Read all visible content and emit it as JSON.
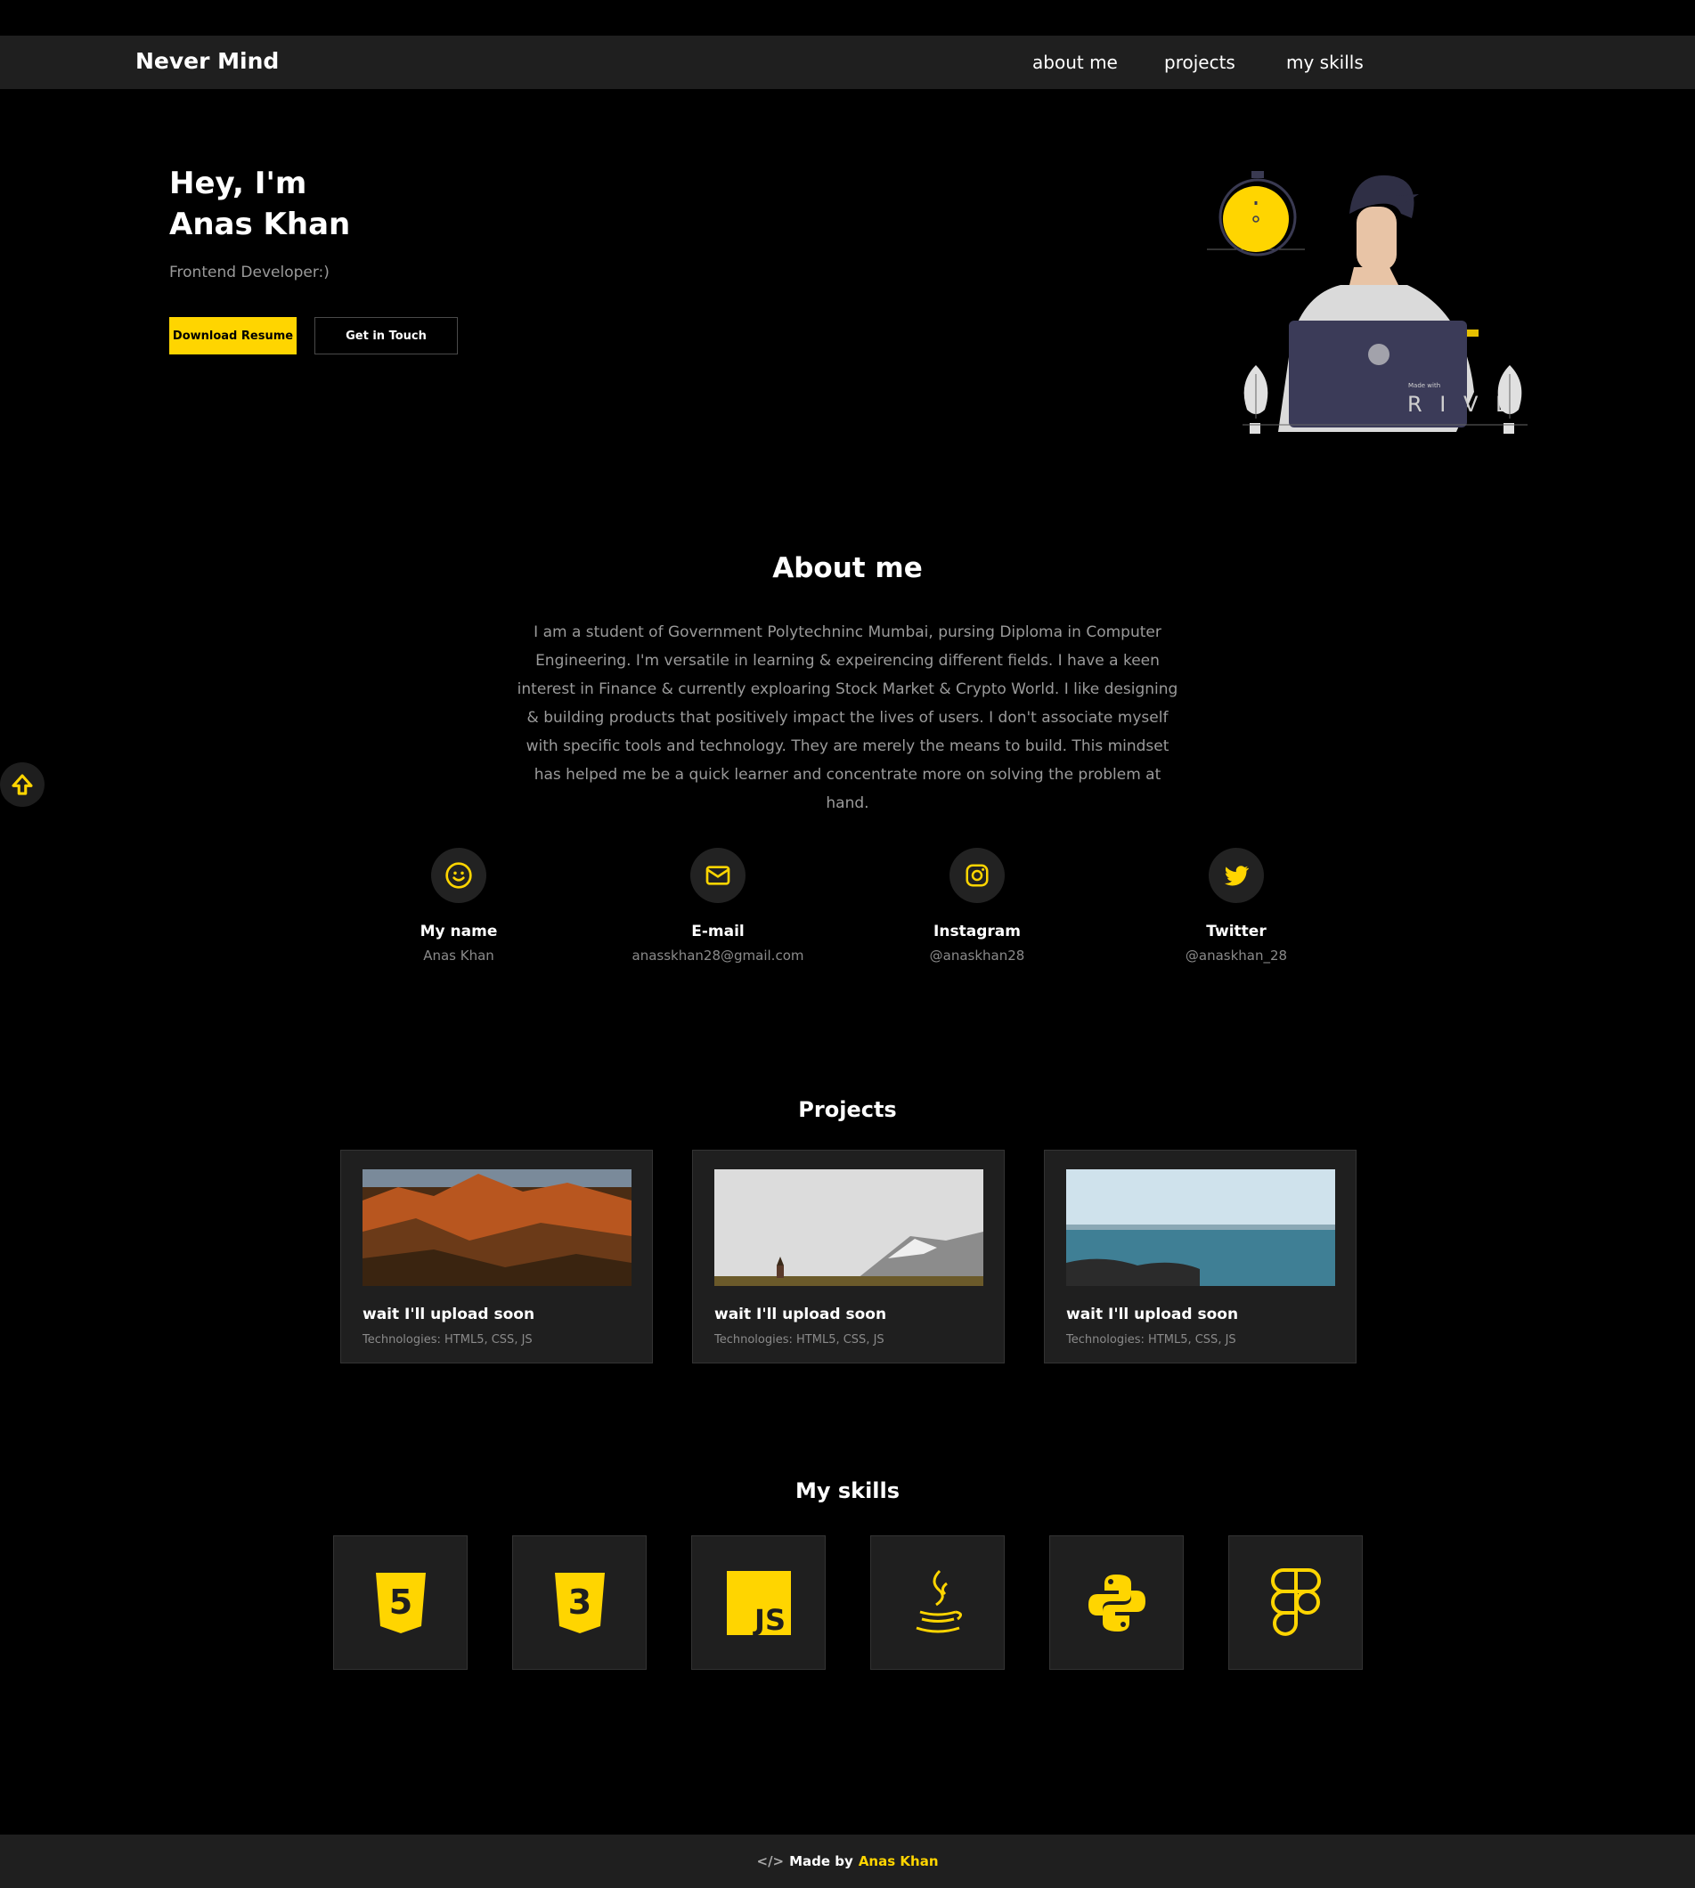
{
  "nav": {
    "brand": "Never Mind",
    "links": [
      "about me",
      "projects",
      "my skills"
    ]
  },
  "hero": {
    "greeting": "Hey, I'm",
    "name": "Anas Khan",
    "role": "Frontend Developer:)",
    "download_label": "Download Resume",
    "contact_label": "Get in Touch",
    "illustration_badge": "Made with",
    "illustration_brand": "R I V E"
  },
  "about": {
    "title": "About me",
    "text": "I am a student of Government Polytechninc Mumbai, pursing Diploma in Computer Engineering. I'm versatile in learning & expeirencing different fields. I have a keen interest in Finance & currently exploaring Stock Market & Crypto World. I like designing & building products that positively impact the lives of users. I don't associate myself with specific tools and technology. They are merely the means to build. This mindset has helped me be a quick learner and concentrate more on solving the problem at hand."
  },
  "contacts": [
    {
      "label": "My name",
      "value": "Anas Khan",
      "icon": "smile-icon"
    },
    {
      "label": "E-mail",
      "value": "anasskhan28@gmail.com",
      "icon": "mail-icon"
    },
    {
      "label": "Instagram",
      "value": "@anaskhan28",
      "icon": "instagram-icon"
    },
    {
      "label": "Twitter",
      "value": "@anaskhan_28",
      "icon": "twitter-icon"
    }
  ],
  "projects": {
    "title": "Projects",
    "items": [
      {
        "title": "wait I'll upload soon",
        "tech": "Technologies: HTML5, CSS, JS"
      },
      {
        "title": "wait I'll upload soon",
        "tech": "Technologies: HTML5, CSS, JS"
      },
      {
        "title": "wait I'll upload soon",
        "tech": "Technologies: HTML5, CSS, JS"
      }
    ]
  },
  "skills": {
    "title": "My skills",
    "icons": [
      "html5-icon",
      "css3-icon",
      "javascript-icon",
      "java-icon",
      "python-icon",
      "figma-icon"
    ],
    "js_label": "JS",
    "html_digit": "5",
    "css_digit": "3"
  },
  "footer": {
    "prefix": "Made by",
    "author": "Anas Khan"
  },
  "colors": {
    "accent": "#ffd500",
    "background": "#000000",
    "surface": "#1f1f1f",
    "muted_text": "#9a9a9a"
  }
}
